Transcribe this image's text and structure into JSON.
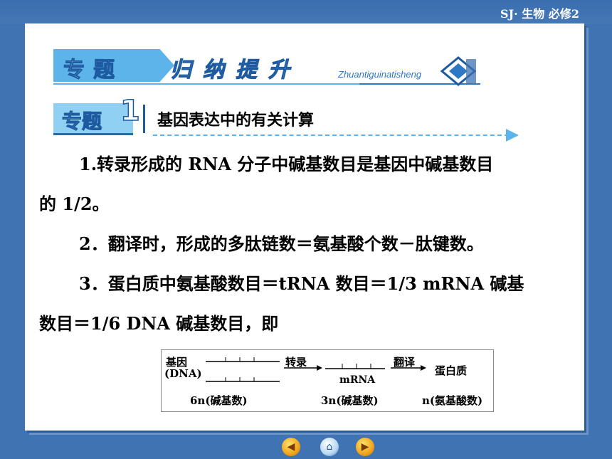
{
  "corner_label": "SJ· 生物  必修2",
  "header": {
    "tab_text": "专题",
    "deco_text": "归纳提升",
    "pinyin": "Zhuantiguinatisheng"
  },
  "section": {
    "badge": "专题",
    "number": "1",
    "title": "基因表达中的有关计算"
  },
  "paragraphs": {
    "p1a": "1.转录形成的 RNA 分子中碱基数目是基因中碱基数目",
    "p1b": "的 1/2。",
    "p2": "2．翻译时，形成的多肽链数＝氨基酸个数－肽键数。",
    "p3a": "3．蛋白质中氨基酸数目＝tRNA 数目＝1/3 mRNA 碱基",
    "p3b": "数目＝1/6 DNA 碱基数目，即"
  },
  "diagram": {
    "gene": "基因",
    "dna": "(DNA)",
    "transcription": "转录",
    "translation": "翻译",
    "mrna": "mRNA",
    "protein": "蛋白质",
    "count_dna": "6n(碱基数)",
    "count_mrna": "3n(碱基数)",
    "count_protein": "n(氨基酸数)"
  },
  "nav": {
    "back_icon": "back-arrow-icon",
    "home_icon": "home-icon",
    "next_icon": "next-arrow-icon"
  }
}
